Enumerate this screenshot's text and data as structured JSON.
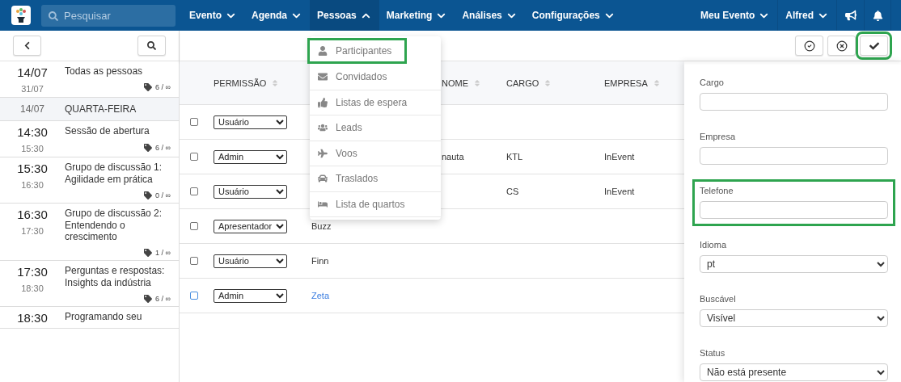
{
  "topbar": {
    "search": {
      "placeholder": "Pesquisar"
    },
    "nav": [
      {
        "label": "Evento",
        "expanded": false
      },
      {
        "label": "Agenda",
        "expanded": false
      },
      {
        "label": "Pessoas",
        "expanded": true
      },
      {
        "label": "Marketing",
        "expanded": false
      },
      {
        "label": "Análises",
        "expanded": false
      },
      {
        "label": "Configurações",
        "expanded": false
      }
    ],
    "right_menus": [
      {
        "label": "Meu Evento"
      },
      {
        "label": "Alfred"
      }
    ]
  },
  "people_menu": {
    "items": [
      {
        "label": "Participantes",
        "kind": "user",
        "highlighted": true
      },
      {
        "label": "Convidados",
        "kind": "envelope",
        "highlighted": false
      },
      {
        "label": "Listas de espera",
        "kind": "thumbs-up",
        "highlighted": false
      },
      {
        "label": "Leads",
        "kind": "users",
        "highlighted": false
      },
      {
        "label": "Voos",
        "kind": "plane",
        "highlighted": false
      },
      {
        "label": "Traslados",
        "kind": "car",
        "highlighted": false
      },
      {
        "label": "Lista de quartos",
        "kind": "bed",
        "highlighted": false
      }
    ]
  },
  "toolbar": {
    "actions": [
      {
        "kind": "check-circle",
        "highlighted": false
      },
      {
        "kind": "x-circle",
        "highlighted": false
      },
      {
        "kind": "check",
        "highlighted": true
      }
    ]
  },
  "sessions": [
    {
      "kind": "session",
      "start": "14/07",
      "end": "31/07",
      "title": "Todas as pessoas",
      "count": "6 / ∞"
    },
    {
      "kind": "day",
      "date": "14/07",
      "title": "QUARTA-FEIRA"
    },
    {
      "kind": "session",
      "start": "14:30",
      "end": "15:30",
      "title": "Sessão de abertura",
      "count": "6 / ∞"
    },
    {
      "kind": "session",
      "start": "15:30",
      "end": "16:30",
      "title": "Grupo de discussão 1: Agilidade em prática",
      "count": "0 / ∞"
    },
    {
      "kind": "session",
      "start": "16:30",
      "end": "17:30",
      "title": "Grupo de discussão 2: Entendendo o crescimento",
      "count": "1 / ∞"
    },
    {
      "kind": "session",
      "start": "17:30",
      "end": "18:30",
      "title": "Perguntas e respostas: Insights da indústria",
      "count": "6 / ∞"
    },
    {
      "kind": "session",
      "start": "18:30",
      "title": "Programando seu"
    }
  ],
  "table": {
    "columns": [
      {
        "label": "PERMISSÃO"
      },
      {
        "label": "NOME"
      },
      {
        "label": "CARGO"
      },
      {
        "label": "EMPRESA"
      }
    ],
    "rows": [
      {
        "checked": false,
        "hovered": false,
        "permission": "Usuário"
      },
      {
        "checked": false,
        "hovered": false,
        "permission": "Admin",
        "last_name": "nauta",
        "cargo": "KTL",
        "company": "InEvent"
      },
      {
        "checked": false,
        "hovered": false,
        "permission": "Usuário",
        "cargo": "CS",
        "company": "InEvent"
      },
      {
        "checked": false,
        "hovered": false,
        "permission": "Apresentador",
        "first_name": "Buzz"
      },
      {
        "checked": false,
        "hovered": false,
        "permission": "Usuário",
        "first_name": "Finn"
      },
      {
        "checked": false,
        "hovered": true,
        "permission": "Admin",
        "first_name": "Zeta"
      }
    ]
  },
  "details": {
    "fields": [
      {
        "label": "Cargo",
        "kind": "input",
        "highlighted": false
      },
      {
        "label": "Empresa",
        "kind": "input",
        "highlighted": false
      },
      {
        "label": "Telefone",
        "kind": "input",
        "highlighted": true
      },
      {
        "label": "Idioma",
        "kind": "select",
        "value": "pt",
        "highlighted": false
      },
      {
        "label": "Buscável",
        "kind": "select",
        "value": "Visível",
        "highlighted": false
      },
      {
        "label": "Status",
        "kind": "select",
        "value": "Não está presente",
        "highlighted": false
      }
    ]
  }
}
